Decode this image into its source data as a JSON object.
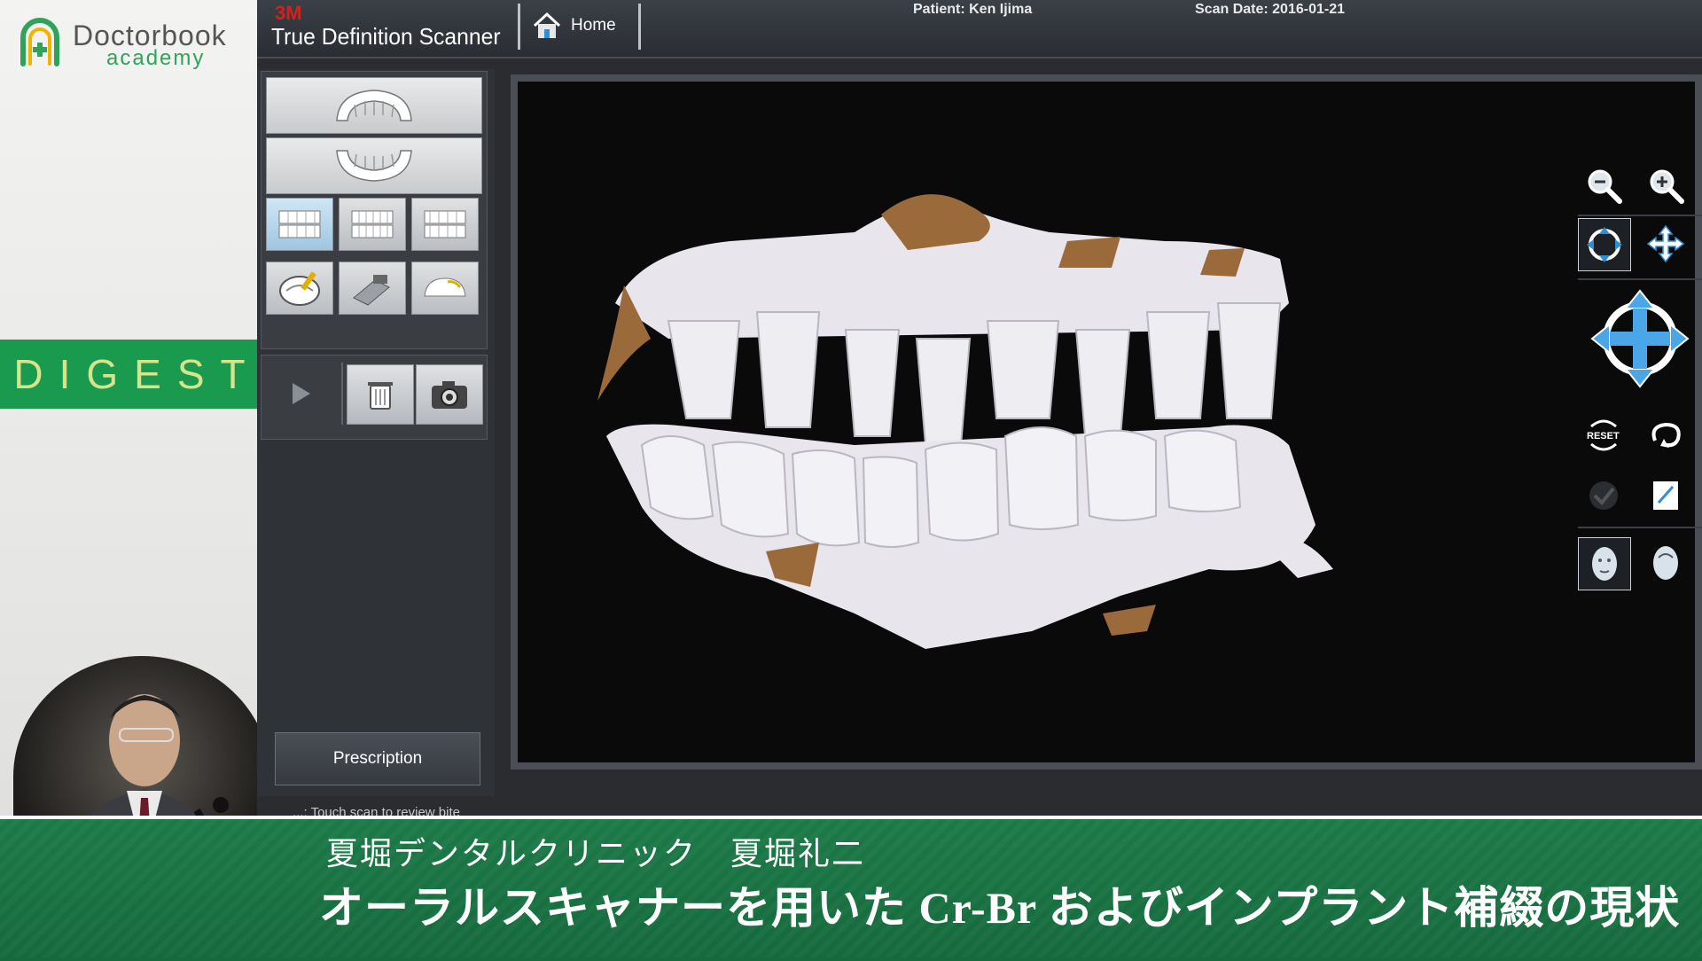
{
  "branding": {
    "name": "Doctorbook",
    "sub": "academy",
    "digest_label": "DIGEST"
  },
  "scanner": {
    "brand_logo": "3M",
    "app_title": "True Definition Scanner",
    "home_label": "Home",
    "patient": "Patient: Ken Ijima",
    "scan_date": "Scan Date: 2016-01-21",
    "prescription_label": "Prescription",
    "hint": "...: Touch scan to review bite",
    "left_tools": [
      {
        "name": "upper-arch-icon"
      },
      {
        "name": "lower-arch-icon"
      },
      {
        "name": "bite-left-icon"
      },
      {
        "name": "bite-front-icon"
      },
      {
        "name": "bite-right-icon"
      },
      {
        "name": "edit-tool-icon"
      },
      {
        "name": "scan-tool-icon"
      },
      {
        "name": "tooth-model-icon"
      }
    ],
    "actions": [
      {
        "name": "play-icon"
      },
      {
        "name": "trash-icon"
      },
      {
        "name": "camera-icon"
      }
    ],
    "right_tools": [
      {
        "name": "zoom-out-icon"
      },
      {
        "name": "zoom-in-icon"
      },
      {
        "name": "rotate-mode-icon"
      },
      {
        "name": "pan-mode-icon"
      },
      {
        "name": "navigation-arrows-icon"
      },
      {
        "name": "reset-view-icon",
        "label": "RESET"
      },
      {
        "name": "undo-rotate-icon"
      },
      {
        "name": "check-icon"
      },
      {
        "name": "notes-icon"
      },
      {
        "name": "face-front-icon"
      },
      {
        "name": "face-profile-icon"
      }
    ]
  },
  "colors": {
    "brand_green": "#1a9a4e",
    "digest_text": "#d8e48a",
    "banner_green": "#1c7a48",
    "scanner_blue": "#2d8fd6",
    "model_white": "#e8e6ec",
    "model_tan": "#9a6a3a"
  },
  "lower_third": {
    "presenter": "夏堀デンタルクリニック　夏堀礼二",
    "title": "オーラルスキャナーを用いた Cr-Br およびインプラント補綴の現状"
  }
}
